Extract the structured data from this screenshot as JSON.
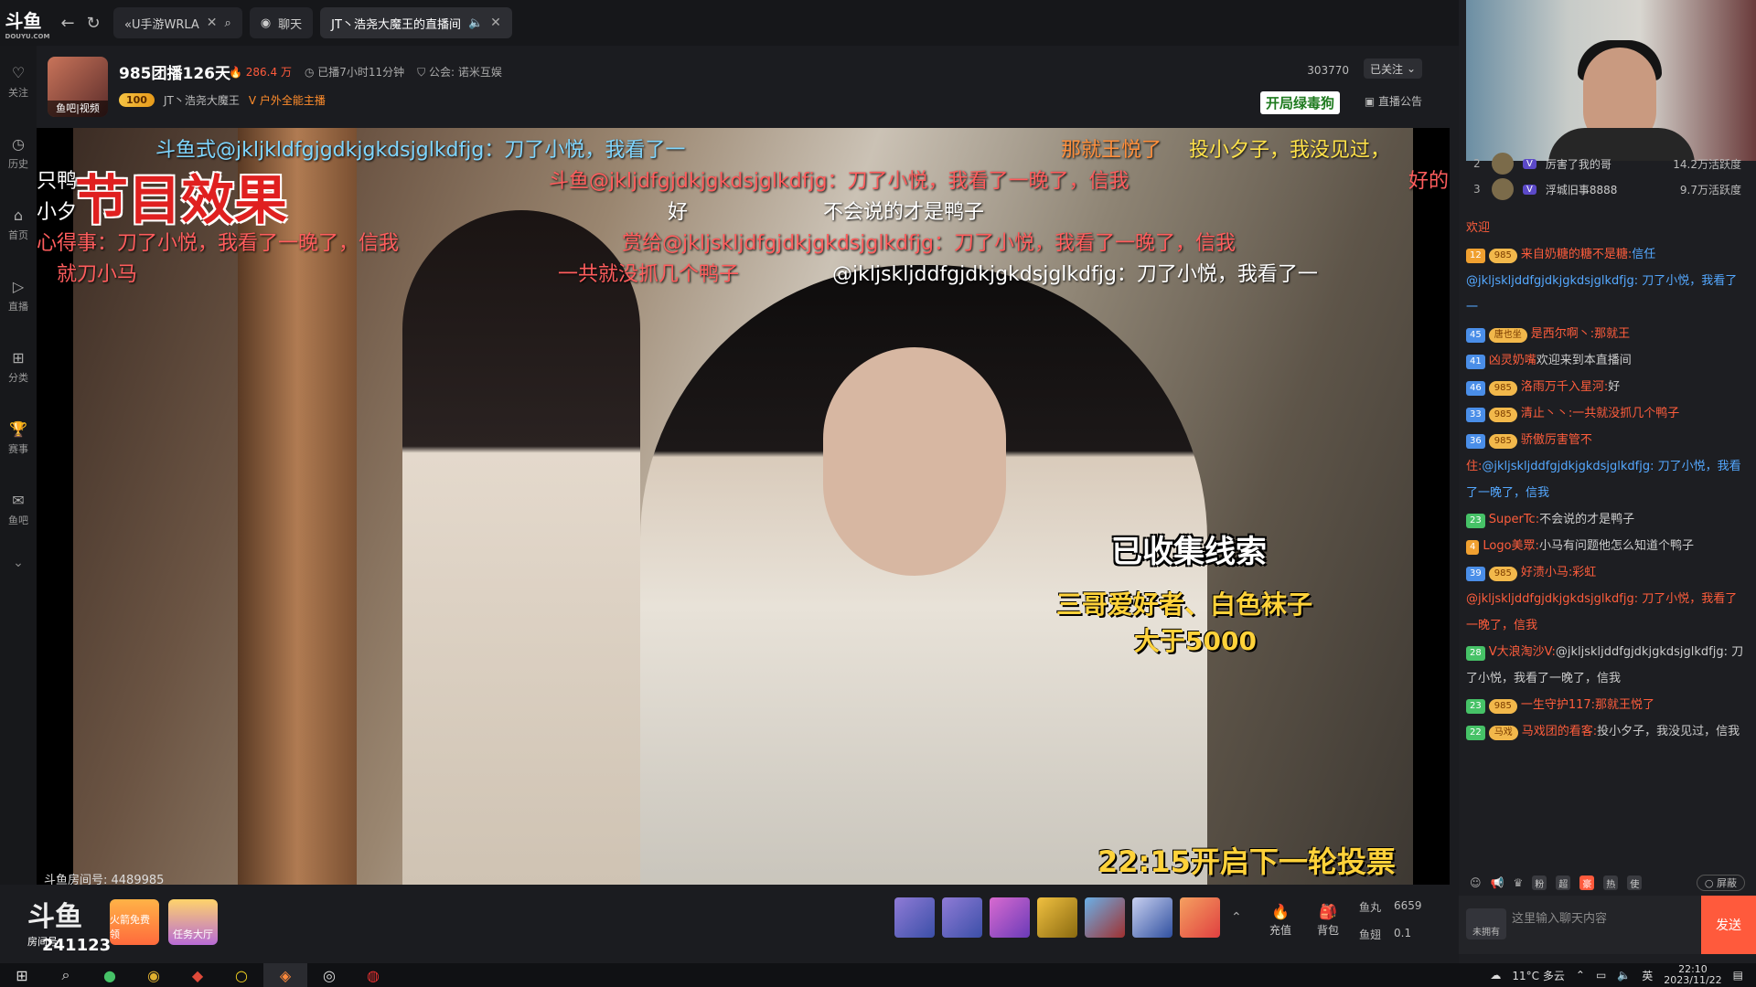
{
  "tabs": [
    {
      "label": "«U手游WRLA",
      "active": false
    },
    {
      "label": "聊天",
      "active": false
    },
    {
      "label": "JT丶浩尧大魔王的直播间",
      "active": true
    }
  ],
  "logo": {
    "main": "斗鱼",
    "sub": "DOUYU.COM"
  },
  "sidebar": [
    {
      "label": "关注",
      "icon": "heart-icon"
    },
    {
      "label": "历史",
      "icon": "clock-icon"
    },
    {
      "label": "首页",
      "icon": "home-icon"
    },
    {
      "label": "直播",
      "icon": "play-icon"
    },
    {
      "label": "分类",
      "icon": "grid-icon"
    },
    {
      "label": "赛事",
      "icon": "trophy-icon"
    },
    {
      "label": "鱼吧",
      "icon": "chat-icon"
    }
  ],
  "room": {
    "avatar_badge": "鱼吧|视频",
    "title": "985团播126天",
    "hot": "286.4 万",
    "duration": "已播7小时11分钟",
    "guild": "公会: 诺米互娱",
    "level": "100",
    "streamer": "JT丶浩尧大魔王",
    "tag": "户外全能主播",
    "room_id": "303770",
    "follow_label": "已关注",
    "green_badge": "开局绿毒狗",
    "notice_label": "直播公告"
  },
  "video": {
    "program_effect": "节目效果",
    "danmu": [
      {
        "text": "斗鱼式@jkljkldfgjgdkjgkdsjglkdfjg：刀了小悦，我看了一",
        "color": "#7fd6ff"
      },
      {
        "text": "那就王悦了",
        "color": "#ff8f3c"
      },
      {
        "text": "投小夕子，我没见过，",
        "color": "#ffe24a"
      },
      {
        "text": "只鸭",
        "color": "#ffffff"
      },
      {
        "text": "斗鱼@jkljdfgjdkjgkdsjglkdfjg：刀了小悦，我看了一晚了，信我",
        "color": "#ff5d5d"
      },
      {
        "text": "好的",
        "color": "#ff5d5d"
      },
      {
        "text": "小夕",
        "color": "#ffffff"
      },
      {
        "text": "好",
        "color": "#ffffff"
      },
      {
        "text": "不会说的才是鸭子",
        "color": "#ffffff"
      },
      {
        "text": "心得事：刀了小悦，我看了一晚了，信我",
        "color": "#ff5d5d"
      },
      {
        "text": "赏给@jkljskljdfgjdkjgkdsjglkdfjg：刀了小悦，我看了一晚了，信我",
        "color": "#ff5d5d"
      },
      {
        "text": "就刀小马",
        "color": "#ff5d5d"
      },
      {
        "text": "一共就没抓几个鸭子",
        "color": "#ff5d5d"
      },
      {
        "text": "@jkljskljddfgjdkjgkdsjglkdfjg：刀了小悦，我看了一",
        "color": "#ffffff"
      }
    ],
    "overlay_clue": "已收集线索",
    "overlay_clue2": "三哥爱好者、白色袜子",
    "overlay_clue3": "大于5000",
    "overlay_vote": "22:15开启下一轮投票",
    "watermark": "斗鱼房间号: 4489985"
  },
  "bottombar": {
    "logo": "斗鱼",
    "room_label": "房间号",
    "room_number": "241123",
    "promo1": "火箭免费领",
    "promo2": "任务大厅",
    "recharge": "充值",
    "backpack": "背包",
    "fishball_label": "鱼丸",
    "fishball_value": "6659",
    "fishfin_label": "鱼翅",
    "fishfin_value": "0.1"
  },
  "rank": [
    {
      "num": "2",
      "name": "厉害了我的哥",
      "fans": "14.2万活跃度"
    },
    {
      "num": "3",
      "name": "浮城旧事8888",
      "fans": "9.7万活跃度"
    }
  ],
  "chat": [
    {
      "lv": "",
      "lvcls": "",
      "fan": "",
      "name": "欢迎",
      "ncls": "red",
      "txt": "",
      "tcls": ""
    },
    {
      "lv": "12",
      "lvcls": "orange",
      "fan": "985",
      "name": "来自奶糖的糖不是糖:",
      "ncls": "red",
      "txt": "信任@jkljskljddfgjdkjgkdsjglkdfjg: 刀了小悦，我看了一",
      "tcls": "blue"
    },
    {
      "lv": "45",
      "lvcls": "blue",
      "fan": "唐也坐",
      "name": "是西尔啊丶:",
      "ncls": "red",
      "txt": "那就王",
      "tcls": "red"
    },
    {
      "lv": "41",
      "lvcls": "blue",
      "fan": "",
      "name": "凶灵奶嘴",
      "ncls": "red",
      "txt": "欢迎来到本直播间",
      "tcls": ""
    },
    {
      "lv": "46",
      "lvcls": "blue",
      "fan": "985",
      "name": "洛雨万千入星河:",
      "ncls": "red",
      "txt": "好",
      "tcls": ""
    },
    {
      "lv": "33",
      "lvcls": "blue",
      "fan": "985",
      "name": "清止丶丶:",
      "ncls": "red",
      "txt": "一共就没抓几个鸭子",
      "tcls": "red"
    },
    {
      "lv": "36",
      "lvcls": "blue",
      "fan": "985",
      "name": "骄傲厉害管不住:",
      "ncls": "red",
      "txt": "@jkljskljddfgjdkjgkdsjglkdfjg: 刀了小悦，我看了一晚了，信我",
      "tcls": "blue"
    },
    {
      "lv": "23",
      "lvcls": "",
      "fan": "",
      "name": "SuperTc:",
      "ncls": "red",
      "txt": "不会说的才是鸭子",
      "tcls": ""
    },
    {
      "lv": "4",
      "lvcls": "orange",
      "fan": "",
      "name": "Logo美眾:",
      "ncls": "red",
      "txt": "小马有问题他怎么知道个鸭子",
      "tcls": ""
    },
    {
      "lv": "39",
      "lvcls": "blue",
      "fan": "985",
      "name": "好溃小马:",
      "ncls": "red",
      "txt": "彩虹@jkljskljddfgjdkjgkdsjglkdfjg: 刀了小悦，我看了一晚了，信我",
      "tcls": "red"
    },
    {
      "lv": "28",
      "lvcls": "",
      "fan": "",
      "name": "V大浪淘沙V:",
      "ncls": "red",
      "txt": "@jkljskljddfgjdkjgkdsjglkdfjg: 刀了小悦，我看了一晚了，信我",
      "tcls": ""
    },
    {
      "lv": "23",
      "lvcls": "",
      "fan": "985",
      "name": "一生守护117:",
      "ncls": "red",
      "txt": "那就王悦了",
      "tcls": "red"
    },
    {
      "lv": "22",
      "lvcls": "",
      "fan": "马戏",
      "name": "马戏团的看客:",
      "ncls": "red",
      "txt": "投小夕子，我没见过，信我",
      "tcls": ""
    }
  ],
  "chat_tools": {
    "block_label": "屏蔽",
    "tags": [
      "粉",
      "超",
      "豪",
      "热",
      "使"
    ]
  },
  "chat_input": {
    "unowned_label": "未拥有",
    "placeholder": "这里输入聊天内容",
    "send_label": "发送"
  },
  "taskbar": {
    "weather": "11°C 多云",
    "ime": "英",
    "time": "22:10",
    "date": "2023/11/22"
  }
}
